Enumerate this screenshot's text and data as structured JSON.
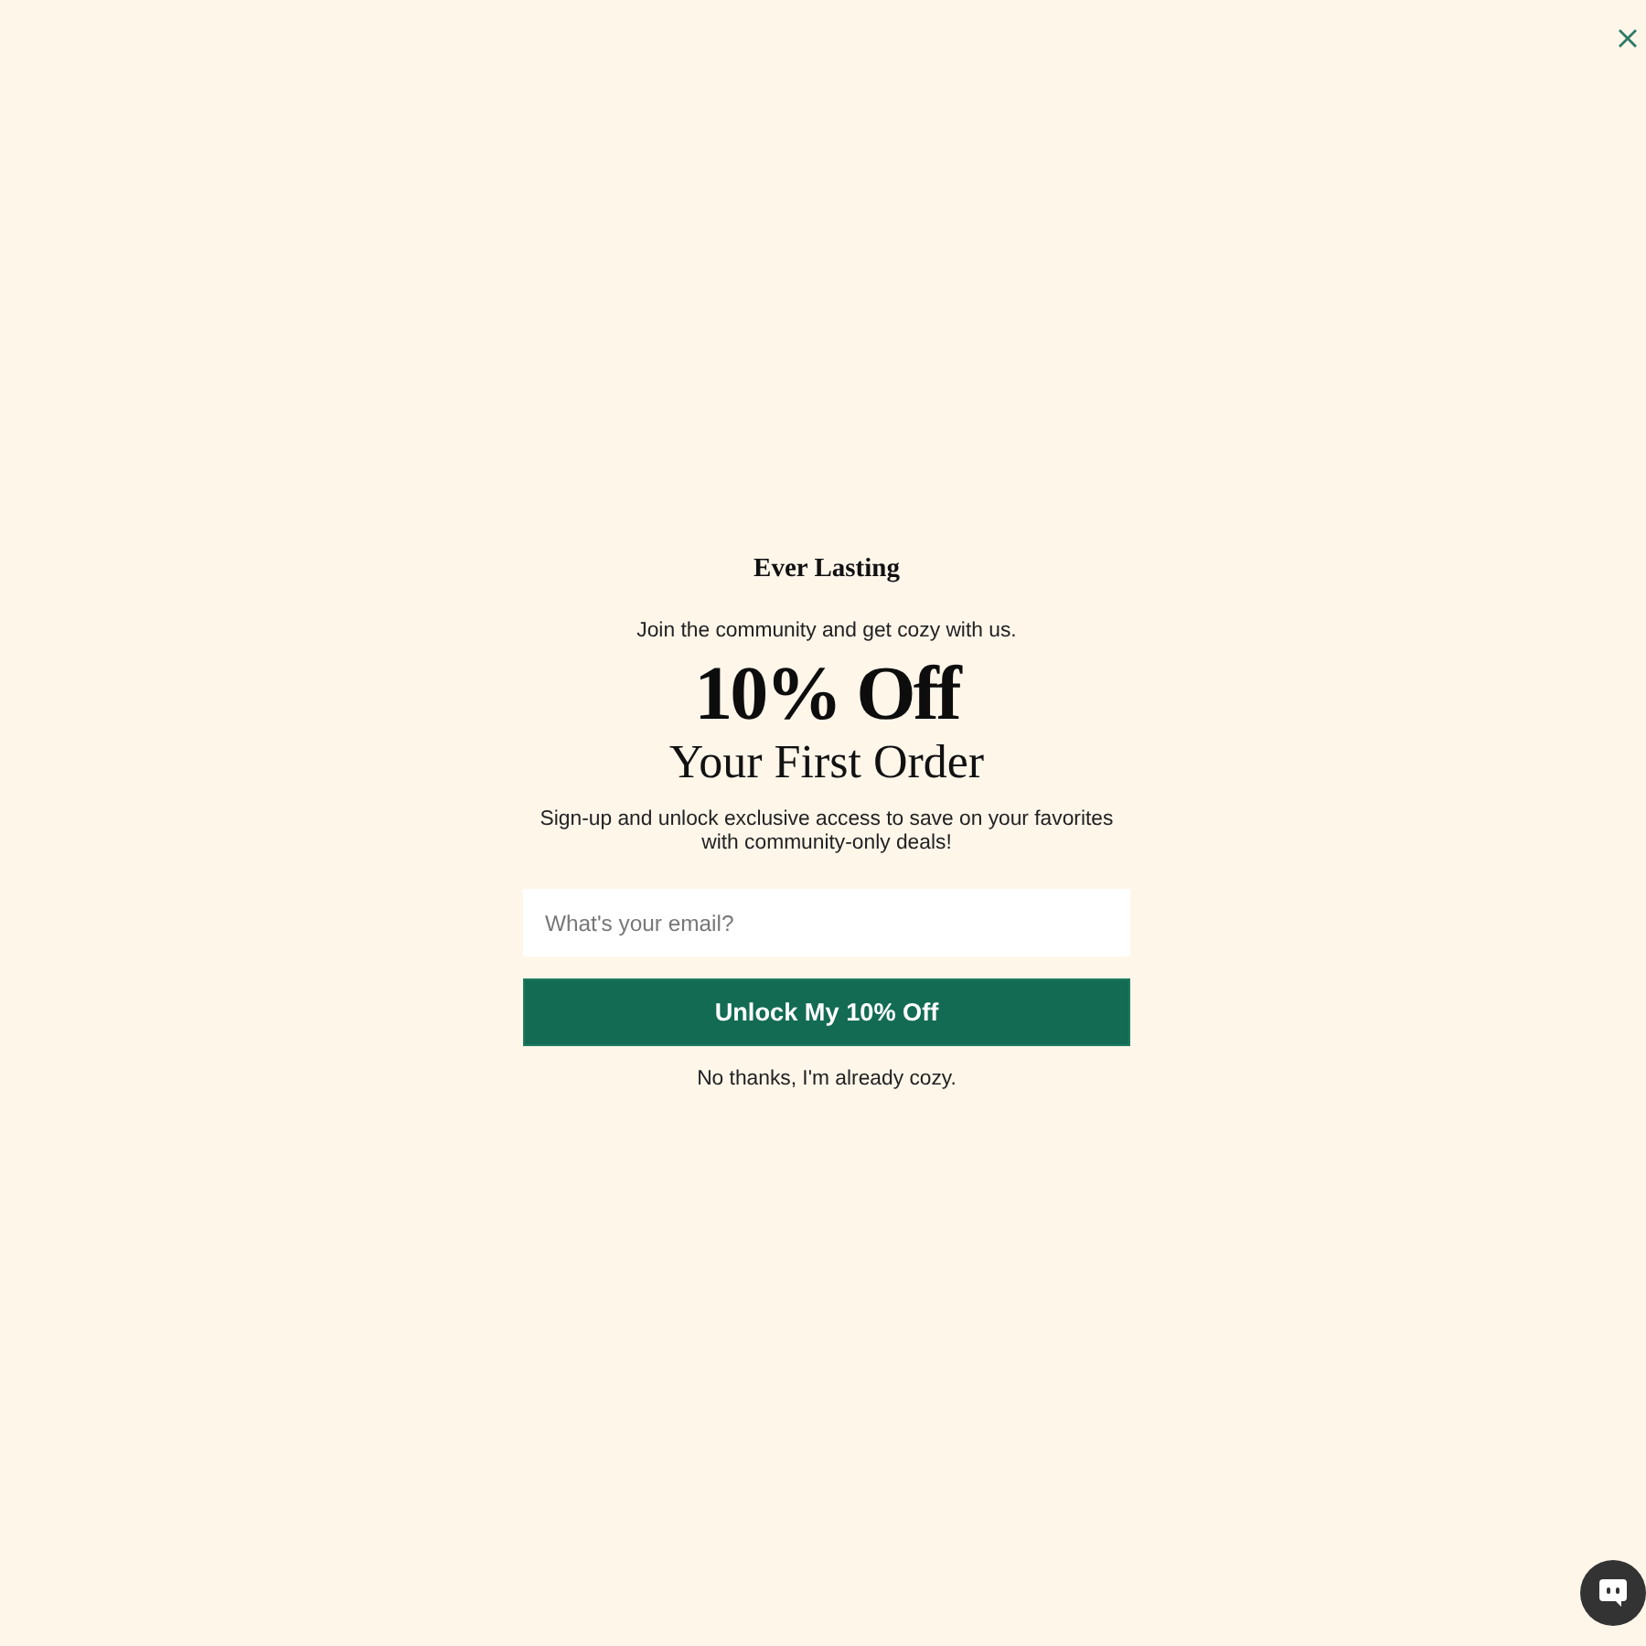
{
  "popup": {
    "brand": "Ever Lasting",
    "tagline": "Join the community and get cozy with us.",
    "headline": "10% Off",
    "subheadline": "Your First Order",
    "description": "Sign-up and unlock exclusive access to save on your favorites with community-only deals!",
    "email_field": {
      "placeholder": "What's your email?"
    },
    "submit_button": "Unlock My 10% Off",
    "decline_link": "No thanks, I'm already cozy."
  }
}
